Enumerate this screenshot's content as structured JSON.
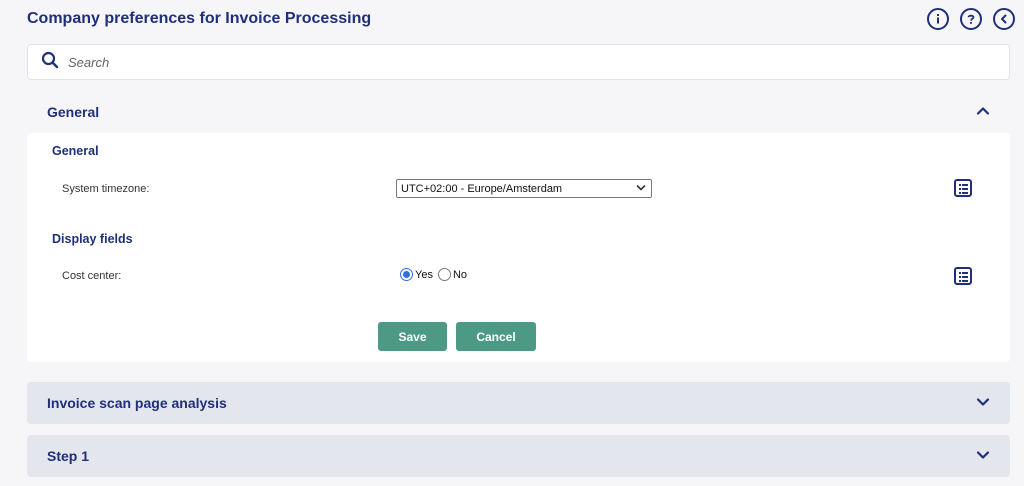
{
  "header": {
    "title": "Company preferences for Invoice Processing",
    "icons": [
      "info-icon",
      "help-icon",
      "back-icon"
    ]
  },
  "search": {
    "placeholder": "Search",
    "value": ""
  },
  "sections": {
    "general": {
      "title": "General",
      "expanded": true,
      "groups": {
        "general": {
          "title": "General",
          "timezone_label": "System timezone:",
          "timezone_value": "UTC+02:00 - Europe/Amsterdam"
        },
        "display": {
          "title": "Display fields",
          "cost_center_label": "Cost center:",
          "options": [
            "Yes",
            "No"
          ],
          "selected": "Yes"
        }
      },
      "save_label": "Save",
      "cancel_label": "Cancel"
    },
    "scan": {
      "title": "Invoice scan page analysis",
      "expanded": false
    },
    "step1": {
      "title": "Step 1",
      "expanded": false
    }
  },
  "colors": {
    "primary": "#1f2f7a",
    "button": "#4c9a86",
    "background": "#f6f6f8",
    "collapsed_header": "#e4e6ee",
    "radio_selected": "#2f6fe0"
  }
}
